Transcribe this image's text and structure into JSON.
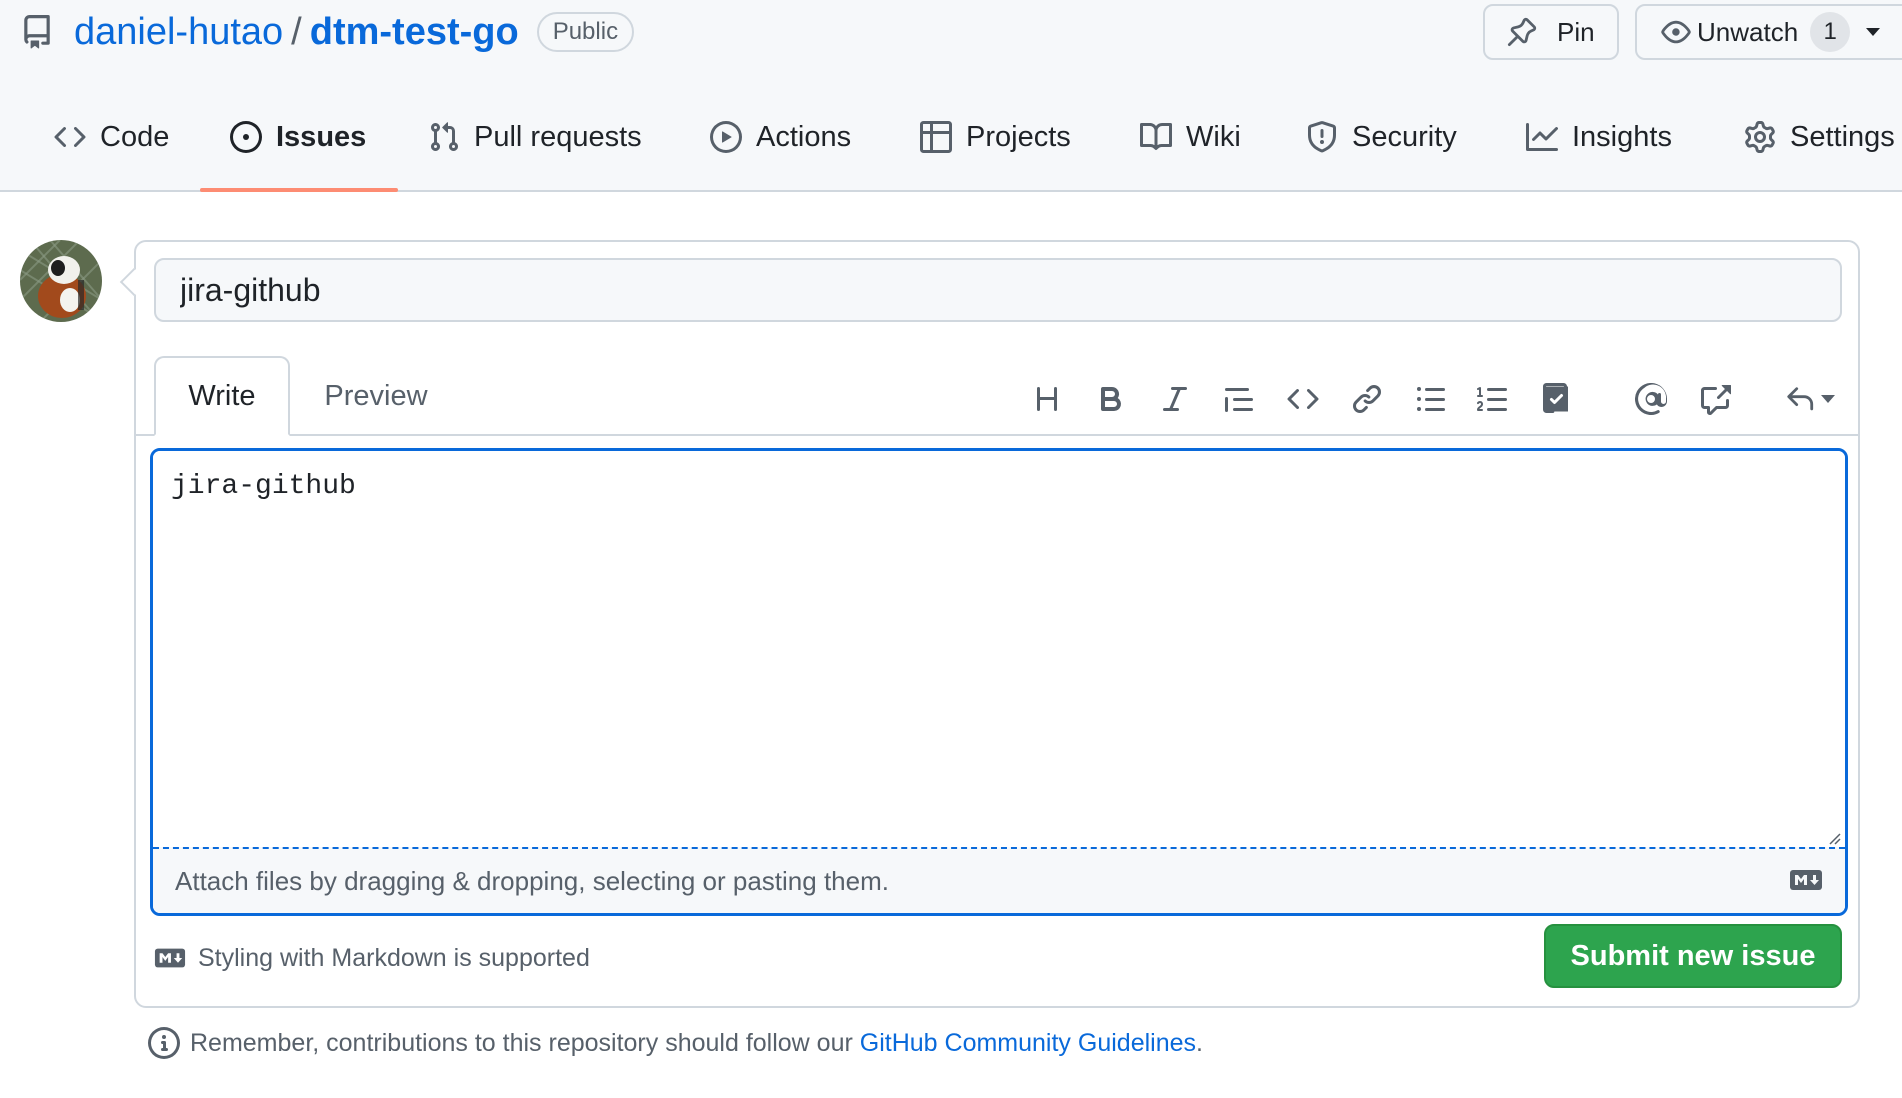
{
  "repo": {
    "owner": "daniel-hutao",
    "separator": "/",
    "name": "dtm-test-go",
    "visibility": "Public"
  },
  "header_actions": {
    "pin_label": "Pin",
    "watch_label": "Unwatch",
    "watch_count": "1"
  },
  "tabs": [
    {
      "label": "Code",
      "icon": "code-icon"
    },
    {
      "label": "Issues",
      "icon": "issue-opened-icon",
      "active": true
    },
    {
      "label": "Pull requests",
      "icon": "git-pull-request-icon"
    },
    {
      "label": "Actions",
      "icon": "play-icon"
    },
    {
      "label": "Projects",
      "icon": "table-icon"
    },
    {
      "label": "Wiki",
      "icon": "book-icon"
    },
    {
      "label": "Security",
      "icon": "shield-icon"
    },
    {
      "label": "Insights",
      "icon": "graph-icon"
    },
    {
      "label": "Settings",
      "icon": "gear-icon"
    }
  ],
  "issue_form": {
    "title_value": "jira-github",
    "body_value": "jira-github",
    "write_tab": "Write",
    "preview_tab": "Preview",
    "attach_hint": "Attach files by dragging & dropping, selecting or pasting them.",
    "markdown_note": "Styling with Markdown is supported",
    "submit_label": "Submit new issue",
    "toolbar": [
      "heading-icon",
      "bold-icon",
      "italic-icon",
      "quote-icon",
      "code-icon",
      "link-icon",
      "unordered-list-icon",
      "ordered-list-icon",
      "task-list-icon",
      "mention-icon",
      "cross-reference-icon",
      "reply-icon"
    ]
  },
  "footer": {
    "prefix": "Remember, contributions to this repository should follow our ",
    "link": "GitHub Community Guidelines",
    "suffix": "."
  },
  "colors": {
    "link": "#0969da",
    "submit": "#2da44e",
    "active_tab_underline": "#fd8c73",
    "focus_border": "#0969da"
  }
}
